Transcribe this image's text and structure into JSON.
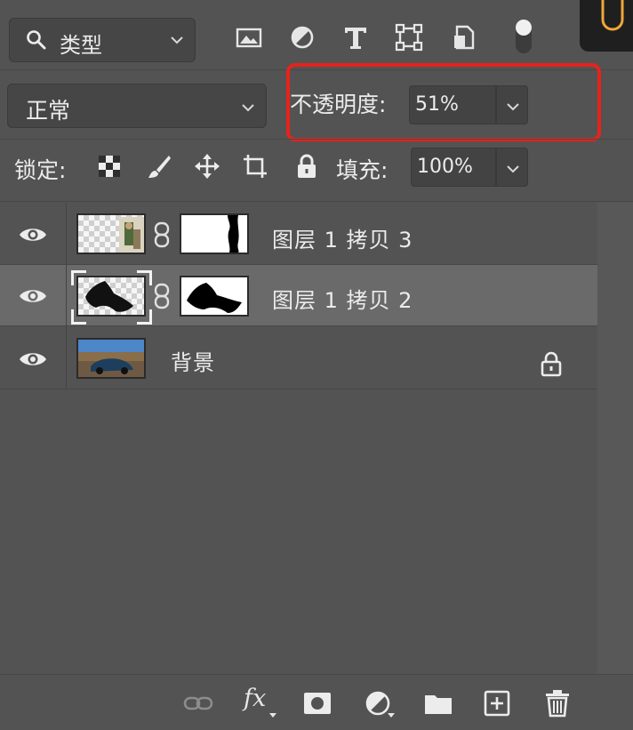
{
  "filter": {
    "label": "类型",
    "icon": "search-icon"
  },
  "filter_icons": [
    "image-filter-icon",
    "adjustment-filter-icon",
    "type-filter-icon",
    "shape-filter-icon",
    "smart-object-filter-icon",
    "filter-toggle-icon"
  ],
  "blend": {
    "mode": "正常"
  },
  "opacity": {
    "label": "不透明度:",
    "value": "51%"
  },
  "lock": {
    "label": "锁定:",
    "icons": [
      "lock-transparent-pixels-icon",
      "lock-image-pixels-icon",
      "lock-position-icon",
      "lock-artboard-icon",
      "lock-all-icon"
    ]
  },
  "fill": {
    "label": "填充:",
    "value": "100%"
  },
  "layers": [
    {
      "name": "图层 1 拷贝 3",
      "visible": true,
      "has_mask": true,
      "selected": false
    },
    {
      "name": "图层 1 拷贝 2",
      "visible": true,
      "has_mask": true,
      "selected": true
    },
    {
      "name": "背景",
      "visible": true,
      "has_mask": false,
      "selected": false,
      "locked": true
    }
  ],
  "bottom_icons": [
    "link-layers-icon",
    "fx-icon",
    "add-mask-icon",
    "adjustment-layer-icon",
    "new-group-icon",
    "new-layer-icon",
    "delete-icon"
  ],
  "bottom": {
    "fx_label": "fx"
  },
  "colors": {
    "panel": "#535353",
    "selected_row": "#6a6a6a",
    "highlight": "#e8221c"
  }
}
